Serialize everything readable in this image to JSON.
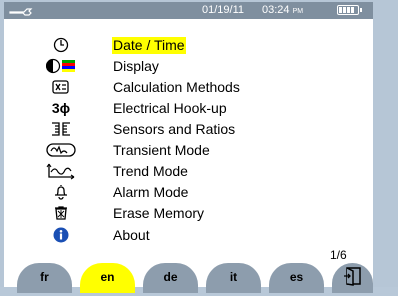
{
  "status": {
    "date": "01/19/11",
    "time": "03:24",
    "ampm": "PM"
  },
  "menu": [
    {
      "label": "Date / Time",
      "icon": "clock-icon",
      "selected": true
    },
    {
      "label": "Display",
      "icon": "contrast-color-icon"
    },
    {
      "label": "Calculation Methods",
      "icon": "calculator-icon"
    },
    {
      "label": "Electrical Hook-up",
      "icon": "three-phase-icon"
    },
    {
      "label": "Sensors and Ratios",
      "icon": "sensor-ratio-icon"
    },
    {
      "label": "Transient Mode",
      "icon": "transient-icon"
    },
    {
      "label": "Trend Mode",
      "icon": "trend-icon"
    },
    {
      "label": "Alarm Mode",
      "icon": "bell-icon"
    },
    {
      "label": "Erase Memory",
      "icon": "trash-icon"
    },
    {
      "label": "About",
      "icon": "info-icon"
    }
  ],
  "page_indicator": "1/6",
  "tabs": [
    {
      "label": "fr"
    },
    {
      "label": "en",
      "active": true
    },
    {
      "label": "de"
    },
    {
      "label": "it"
    },
    {
      "label": "es"
    }
  ],
  "colors": {
    "highlight": "#ffff00",
    "tab": "#8d9dad",
    "statusbar": "#7f8f9f"
  }
}
